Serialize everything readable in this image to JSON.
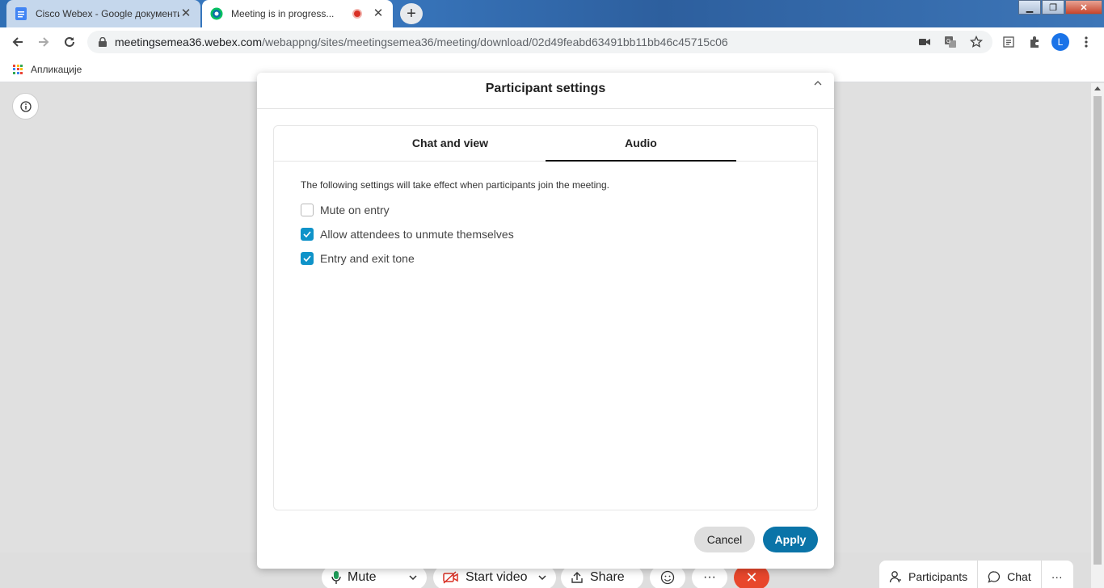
{
  "browser": {
    "tabs": [
      {
        "title": "Cisco Webex - Google документи",
        "favicon": "google-docs-icon",
        "active": false
      },
      {
        "title": "Meeting is in progress...",
        "favicon": "webex-icon",
        "active": true,
        "recording": true
      }
    ],
    "url_host": "meetingsemea36.webex.com",
    "url_path": "/webappng/sites/meetingsemea36/meeting/download/02d49feabd63491bb11bb46c45715c06",
    "profile_initial": "L",
    "bookmarks_apps_label": "Апликације",
    "accent_color": "#1a73e8"
  },
  "modal": {
    "title": "Participant settings",
    "tabs": [
      {
        "label": "Chat and view",
        "active": false
      },
      {
        "label": "Audio",
        "active": true
      }
    ],
    "description": "The following settings will take effect when participants join the meeting.",
    "options": [
      {
        "label": "Mute on entry",
        "checked": false
      },
      {
        "label": "Allow attendees to unmute themselves",
        "checked": true
      },
      {
        "label": "Entry and exit tone",
        "checked": true
      }
    ],
    "cancel_label": "Cancel",
    "apply_label": "Apply",
    "apply_color": "#0a74a8",
    "checkbox_color": "#0f93c9"
  },
  "meeting_bar": {
    "mute_label": "Mute",
    "start_video_label": "Start video",
    "share_label": "Share",
    "more_label": "···",
    "end_color": "#e8472c",
    "participants_label": "Participants",
    "chat_label": "Chat",
    "panel_more_label": "···"
  }
}
